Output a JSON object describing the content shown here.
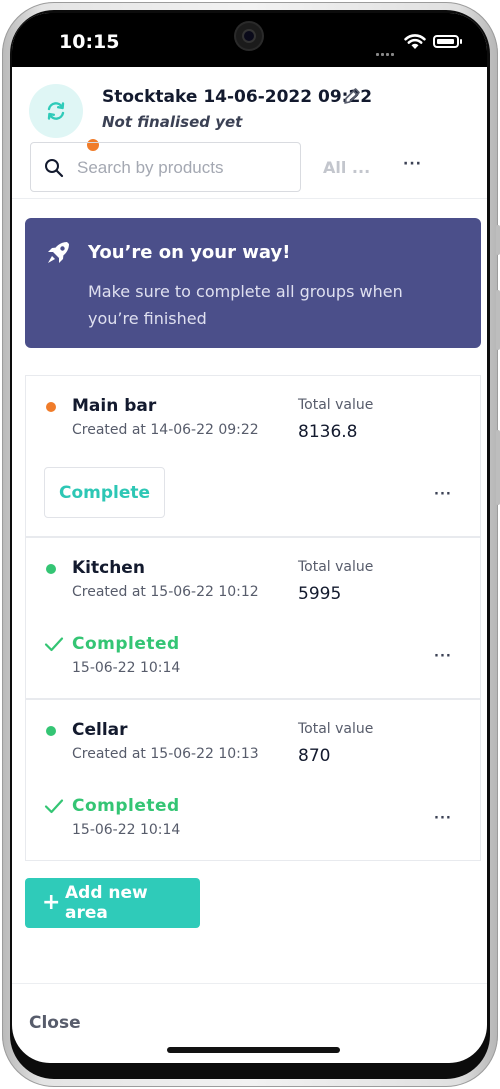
{
  "status_bar": {
    "time": "10:15"
  },
  "header": {
    "title": "Stocktake 14-06-2022 09:22",
    "status": "Not finalised yet",
    "search_placeholder": "Search by products",
    "filter_label": "All ...",
    "more_label": "···"
  },
  "banner": {
    "title": "You’re on your way!",
    "body": "Make sure to complete all groups when you’re finished"
  },
  "areas": [
    {
      "name": "Main bar",
      "created": "Created at 14-06-22 09:22",
      "total_label": "Total value",
      "total_value": "8136.8",
      "status_color": "#f07c2a",
      "action_label": "Complete",
      "more": "···"
    },
    {
      "name": "Kitchen",
      "created": "Created at 15-06-22 10:12",
      "total_label": "Total value",
      "total_value": "5995",
      "status_color": "#34c574",
      "completed_label": "Completed",
      "completed_date": "15-06-22 10:14",
      "more": "···"
    },
    {
      "name": "Cellar",
      "created": "Created at 15-06-22 10:13",
      "total_label": "Total value",
      "total_value": "870",
      "status_color": "#34c574",
      "completed_label": "Completed",
      "completed_date": "15-06-22 10:14",
      "more": "···"
    }
  ],
  "add_area": {
    "icon": "+",
    "label": "Add new area"
  },
  "footer": {
    "close_label": "Close"
  },
  "icons": {
    "avatar": "sync-icon",
    "edit": "pencil-icon",
    "search": "search-icon",
    "banner": "rocket-icon",
    "completed": "check-icon"
  },
  "colors": {
    "accent": "#2fcbb9",
    "banner_bg": "#4b4f8a",
    "pending": "#f07c2a",
    "success": "#34c574"
  }
}
